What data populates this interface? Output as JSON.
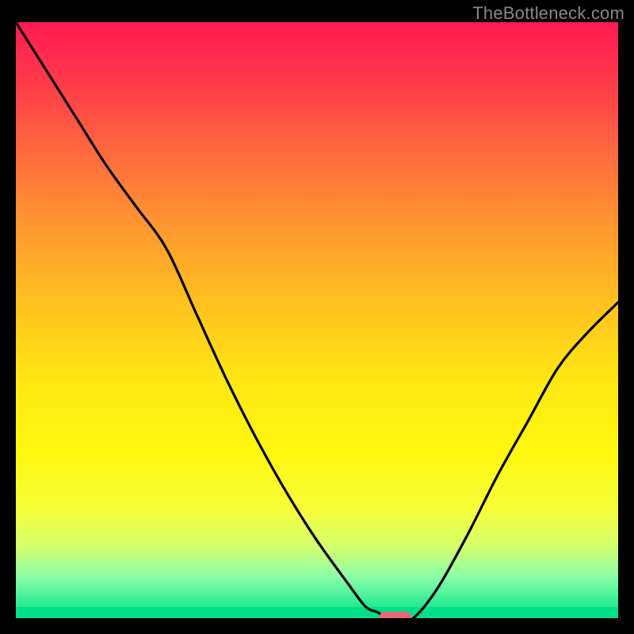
{
  "watermark": "TheBottleneck.com",
  "colors": {
    "curve": "#000000",
    "pill": "#e96a77",
    "band": "#00e08a",
    "text": "#888888"
  },
  "chart_data": {
    "type": "line",
    "title": "",
    "xlabel": "",
    "ylabel": "",
    "xlim": [
      0,
      100
    ],
    "ylim": [
      0,
      100
    ],
    "notes": "Bottleneck-percentage style curve; y≈0 is optimal, rising toward 100 at extremes. X is relative position across the horizontal axis (approx. hardware capability ratio). A short horizontal segment near x≈62–66 sits at y≈0 (green zone) with a rounded marker pill.",
    "x": [
      0,
      5,
      10,
      15,
      20,
      25,
      30,
      35,
      40,
      45,
      50,
      55,
      58,
      60,
      62,
      64,
      66,
      70,
      75,
      80,
      85,
      90,
      95,
      100
    ],
    "y": [
      100,
      92,
      84,
      76,
      69,
      62,
      51,
      40,
      30,
      21,
      13,
      6,
      2,
      1,
      0,
      0,
      0,
      5,
      14,
      24,
      33,
      42,
      48,
      53
    ],
    "optimal_marker_x": 63
  }
}
